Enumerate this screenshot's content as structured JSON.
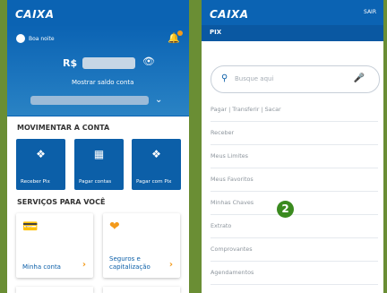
{
  "left_screen": {
    "logo": "CAIXA",
    "greeting": "Boa noite",
    "currency": "R$",
    "show_balance": "Mostrar saldo conta",
    "section_move": "MOVIMENTAR A CONTA",
    "actions": [
      {
        "label": "Receber Pix",
        "icon": "pix-icon"
      },
      {
        "label": "Pagar contas",
        "icon": "barcode-icon"
      },
      {
        "label": "Pagar com Pix",
        "icon": "pix-icon"
      }
    ],
    "section_services": "SERVIÇOS PARA VOCÊ",
    "services": [
      {
        "label": "Minha conta",
        "icon": "wallet-icon"
      },
      {
        "label": "Seguros e capitalização",
        "icon": "heart-hands-icon"
      }
    ]
  },
  "right_screen": {
    "logo": "CAIXA",
    "exit": "SAIR",
    "title": "PIX",
    "search_placeholder": "Busque aqui",
    "menu_items": [
      "Pagar | Transferir | Sacar",
      "Receber",
      "Meus Limites",
      "Meus Favoritos",
      "Minhas Chaves",
      "Extrato",
      "Comprovantes",
      "Agendamentos"
    ]
  },
  "step_badge": "2",
  "colors": {
    "primary_blue": "#0b63b3",
    "accent_orange": "#f39a1b",
    "step_green": "#3a8a1f",
    "frame_green": "#6a8e34"
  }
}
